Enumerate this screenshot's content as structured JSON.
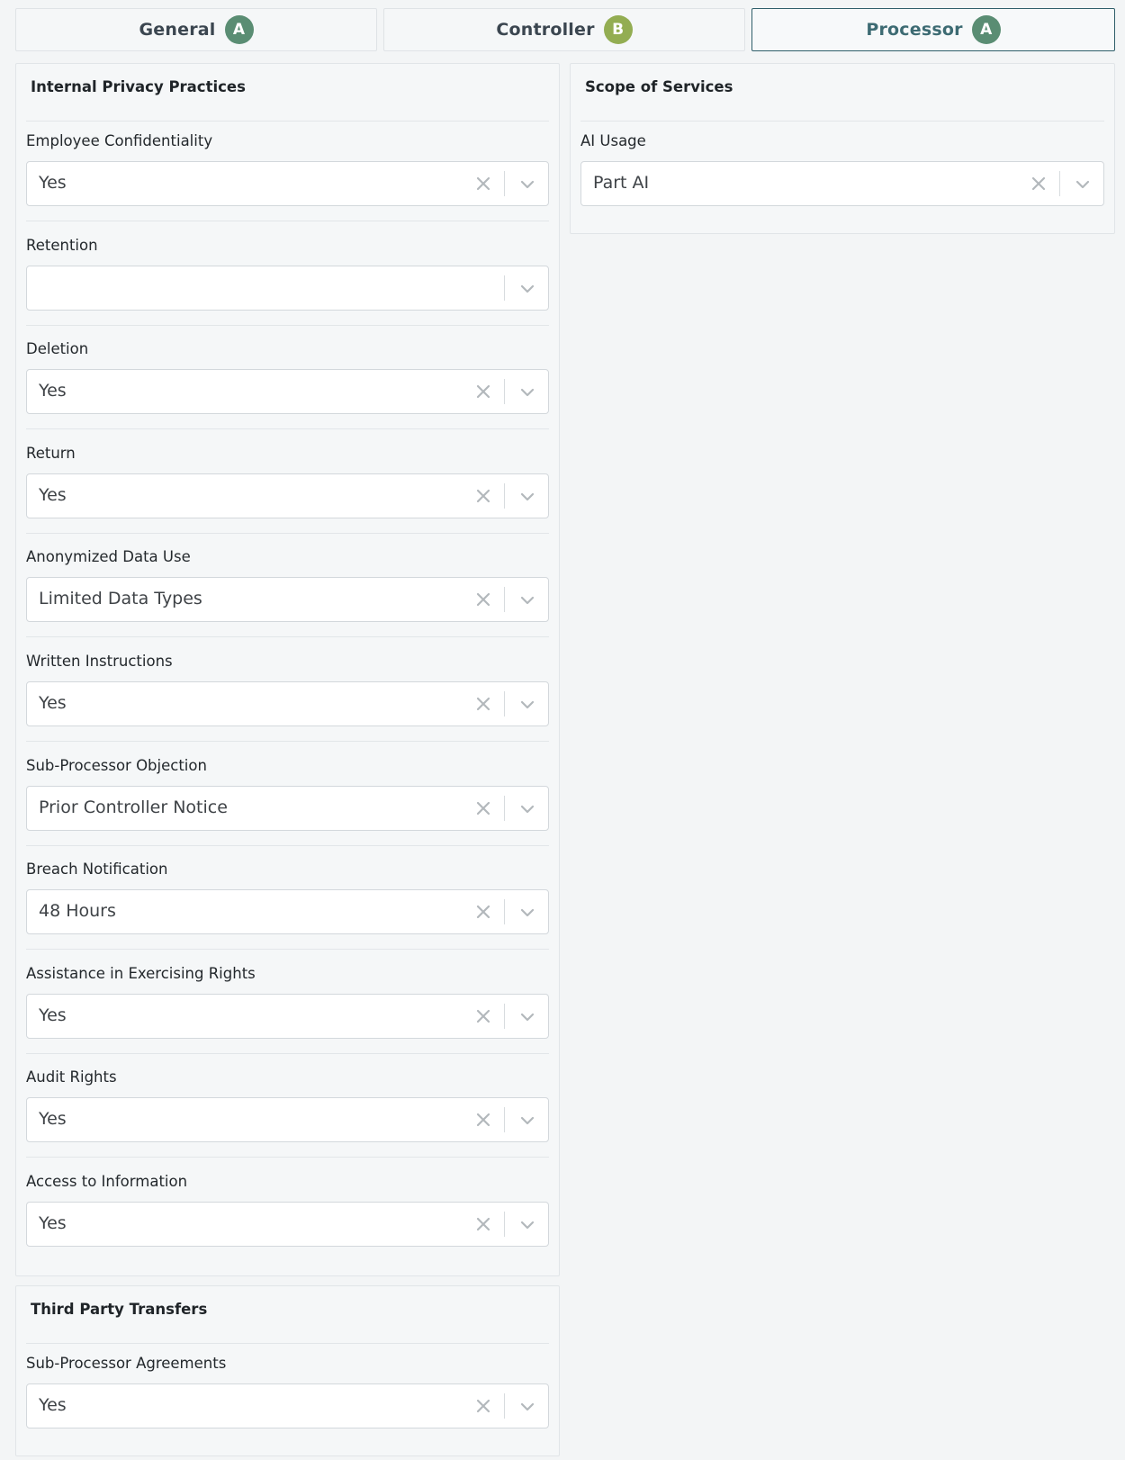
{
  "colors": {
    "grade_a": "#5a8d73",
    "grade_b": "#93ad52",
    "active_tab_border": "#2f5e6a"
  },
  "tabs": [
    {
      "label": "General",
      "grade": "A"
    },
    {
      "label": "Controller",
      "grade": "B"
    },
    {
      "label": "Processor",
      "grade": "A"
    }
  ],
  "internal_privacy": {
    "title": "Internal Privacy Practices",
    "fields": [
      {
        "label": "Employee Confidentiality",
        "value": "Yes"
      },
      {
        "label": "Retention",
        "value": ""
      },
      {
        "label": "Deletion",
        "value": "Yes"
      },
      {
        "label": "Return",
        "value": "Yes"
      },
      {
        "label": "Anonymized Data Use",
        "value": "Limited Data Types"
      },
      {
        "label": "Written Instructions",
        "value": "Yes"
      },
      {
        "label": "Sub-Processor Objection",
        "value": "Prior Controller Notice"
      },
      {
        "label": "Breach Notification",
        "value": "48 Hours"
      },
      {
        "label": "Assistance in Exercising Rights",
        "value": "Yes"
      },
      {
        "label": "Audit Rights",
        "value": "Yes"
      },
      {
        "label": "Access to Information",
        "value": "Yes"
      }
    ]
  },
  "third_party": {
    "title": "Third Party Transfers",
    "fields": [
      {
        "label": "Sub-Processor Agreements",
        "value": "Yes"
      }
    ]
  },
  "scope": {
    "title": "Scope of Services",
    "fields": [
      {
        "label": "AI Usage",
        "value": "Part AI"
      }
    ]
  }
}
